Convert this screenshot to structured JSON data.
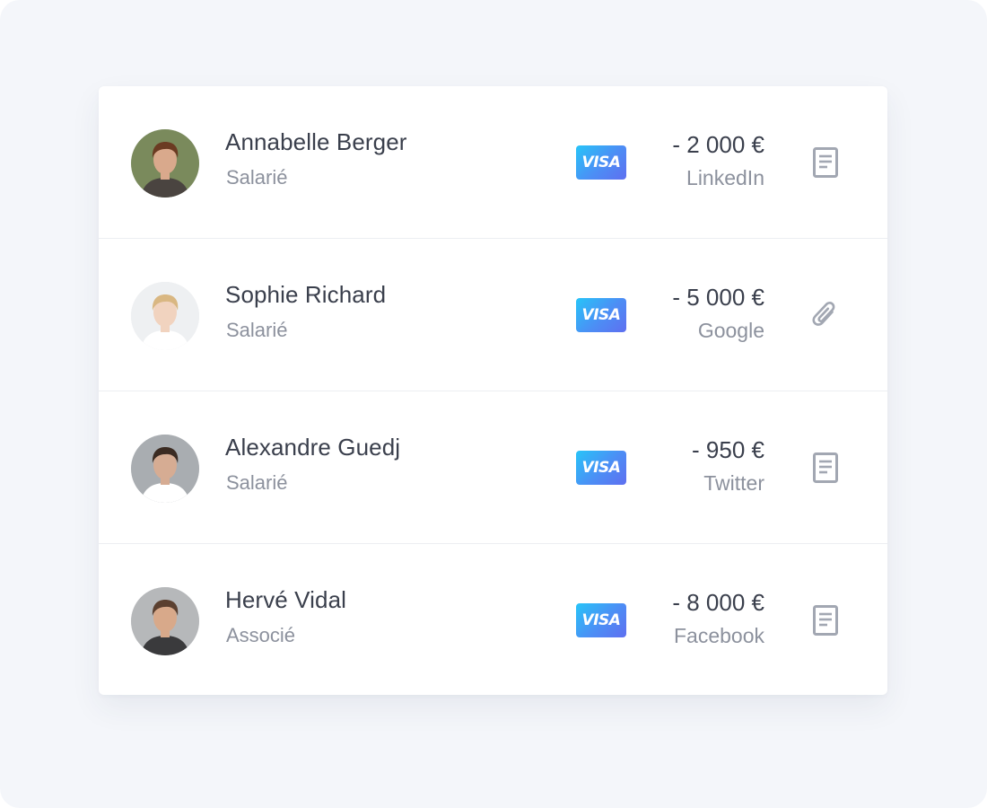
{
  "transactions": [
    {
      "name": "Annabelle Berger",
      "role": "Salarié",
      "card_brand": "VISA",
      "amount": "- 2 000 €",
      "source": "LinkedIn",
      "action_icon": "document-icon",
      "avatar": {
        "skin": "#d9a98c",
        "hair": "#6b3b22",
        "bg": "#7a8a5c",
        "shirt": "#4a4440"
      }
    },
    {
      "name": "Sophie Richard",
      "role": "Salarié",
      "card_brand": "VISA",
      "amount": "- 5 000 €",
      "source": "Google",
      "action_icon": "paperclip-icon",
      "avatar": {
        "skin": "#f1d3bf",
        "hair": "#d9b782",
        "bg": "#eef0f2",
        "shirt": "#ffffff"
      }
    },
    {
      "name": "Alexandre Guedj",
      "role": "Salarié",
      "card_brand": "VISA",
      "amount": "- 950 €",
      "source": "Twitter",
      "action_icon": "document-icon",
      "avatar": {
        "skin": "#d6ac93",
        "hair": "#3b2b22",
        "bg": "#a9adb1",
        "shirt": "#ffffff"
      }
    },
    {
      "name": "Hervé Vidal",
      "role": "Associé",
      "card_brand": "VISA",
      "amount": "- 8 000 €",
      "source": "Facebook",
      "action_icon": "document-icon",
      "avatar": {
        "skin": "#d8a98a",
        "hair": "#5b4030",
        "bg": "#b6b8ba",
        "shirt": "#3a3a3c"
      }
    }
  ],
  "colors": {
    "page_background": "#f4f6fa",
    "card_background": "#ffffff",
    "text_primary": "#3a3f4c",
    "text_secondary": "#8c919d",
    "icon_gray": "#a2a7b2",
    "visa_gradient_start": "#27c4f8",
    "visa_gradient_end": "#5f6ff0"
  }
}
